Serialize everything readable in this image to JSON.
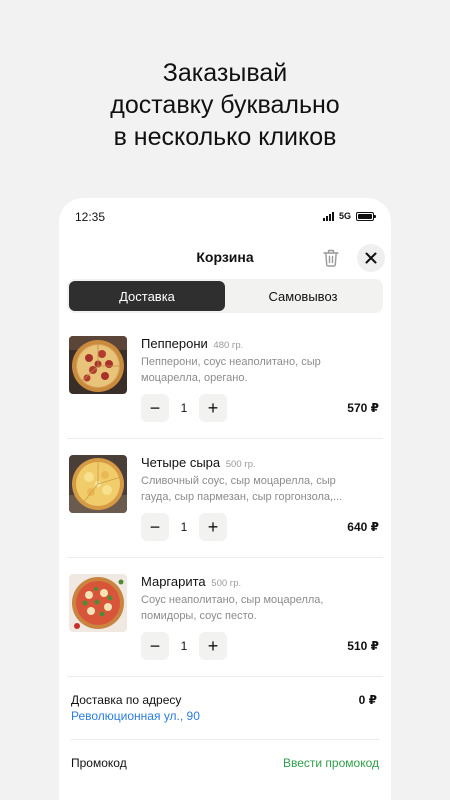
{
  "headline": {
    "line1": "Заказывай",
    "line2": "доставку буквально",
    "line3": "в несколько кликов"
  },
  "status_bar": {
    "time": "12:35",
    "network": "5G",
    "icons": [
      "signal-icon",
      "battery-icon"
    ]
  },
  "cart": {
    "title": "Корзина",
    "icons": [
      "trash-icon",
      "close-icon"
    ]
  },
  "tabs": [
    {
      "label": "Доставка",
      "active": true
    },
    {
      "label": "Самовывоз",
      "active": false
    }
  ],
  "items": [
    {
      "name": "Пепперони",
      "weight": "480 гр.",
      "desc_line1": "Пепперони, соус неаполитано, сыр",
      "desc_line2": "моцарелла, орегано.",
      "quantity": "1",
      "price": "570 ₽",
      "minus": "−",
      "plus": "+"
    },
    {
      "name": "Четыре сыра",
      "weight": "500 гр.",
      "desc_line1": "Сливочный соус, сыр моцарелла, сыр",
      "desc_line2": "гауда, сыр пармезан, сыр горгонзола,...",
      "quantity": "1",
      "price": "640 ₽",
      "minus": "−",
      "plus": "+"
    },
    {
      "name": "Маргарита",
      "weight": "500 гр.",
      "desc_line1": "Соус неаполитано, сыр моцарелла,",
      "desc_line2": "помидоры, соус песто.",
      "quantity": "1",
      "price": "510 ₽",
      "minus": "−",
      "plus": "+"
    }
  ],
  "delivery": {
    "label": "Доставка по адресу",
    "address": "Революционная ул., 90",
    "price": "0 ₽"
  },
  "promo": {
    "label": "Промокод",
    "link": "Ввести промокод"
  },
  "colors": {
    "background": "#f2f2f2",
    "active_tab": "#2f2f2f",
    "address_link": "#2a7de1",
    "promo_link": "#2f9e4a"
  }
}
